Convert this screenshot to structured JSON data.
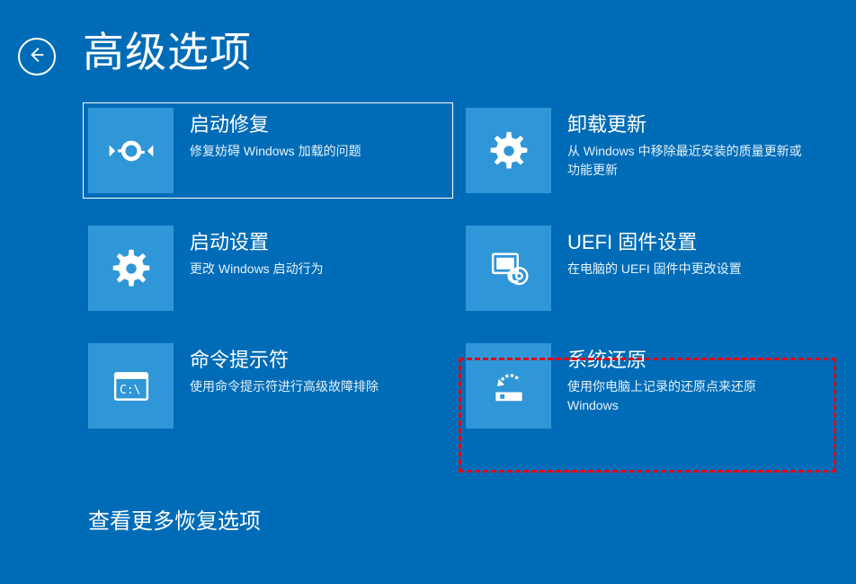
{
  "header": {
    "title": "高级选项"
  },
  "tiles": {
    "startup_repair": {
      "title": "启动修复",
      "desc": "修复妨碍 Windows 加载的问题"
    },
    "uninstall_updates": {
      "title": "卸载更新",
      "desc": "从 Windows 中移除最近安装的质量更新或功能更新"
    },
    "startup_settings": {
      "title": "启动设置",
      "desc": "更改 Windows 启动行为"
    },
    "uefi": {
      "title": "UEFI 固件设置",
      "desc": "在电脑的 UEFI 固件中更改设置"
    },
    "command_prompt": {
      "title": "命令提示符",
      "desc": "使用命令提示符进行高级故障排除"
    },
    "system_restore": {
      "title": "系统还原",
      "desc": "使用你电脑上记录的还原点来还原 Windows"
    }
  },
  "footer": {
    "more_options": "查看更多恢复选项"
  }
}
